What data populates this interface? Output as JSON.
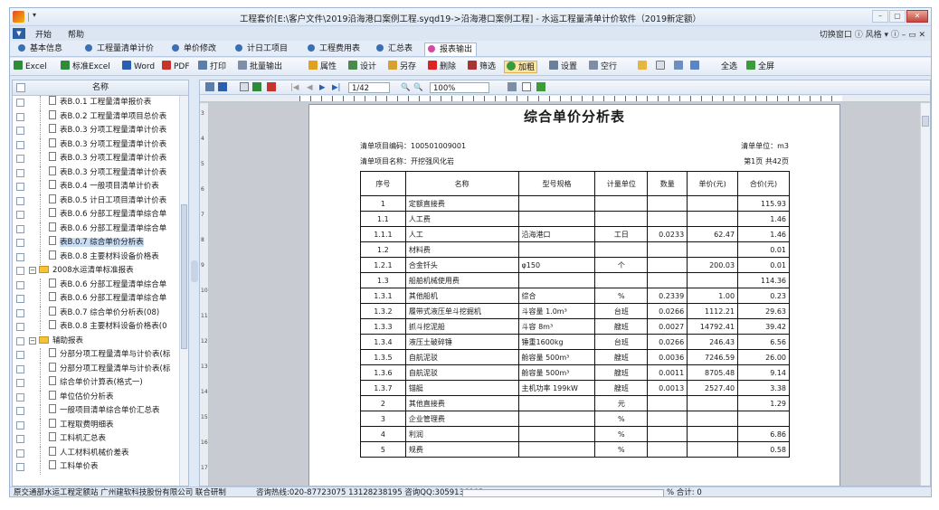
{
  "window": {
    "title": "工程套价[E:\\客户文件\\2019沿海港口案例工程.syqd19->沿海港口案例工程] - 水运工程量清单计价软件（2019新定额）",
    "quick_access": "▾",
    "controls": {
      "min": "–",
      "max": "▢",
      "close": "✕"
    }
  },
  "menu": {
    "dropdown": "▼",
    "items": [
      "开始",
      "帮助"
    ],
    "right": "切换窗口  ⓘ 风格 ▾ ⓘ – ▭ ✕"
  },
  "tabs": [
    "基本信息",
    "工程量清单计价",
    "单价修改",
    "计日工项目",
    "工程费用表",
    "汇总表",
    "报表输出"
  ],
  "toolbar": [
    "Excel",
    "标准Excel",
    "Word",
    "PDF",
    "打印",
    "批量输出",
    "属性",
    "设计",
    "另存",
    "删除",
    "筛选",
    "加粗",
    "设置",
    "空行",
    "全选",
    "全屏"
  ],
  "tree": {
    "header": "名称",
    "items": [
      {
        "label": "表B.0.1 工程量清单报价表",
        "type": "doc",
        "indent": 2
      },
      {
        "label": "表B.0.2 工程量清单项目总价表",
        "type": "doc",
        "indent": 2
      },
      {
        "label": "表B.0.3 分项工程量清单计价表",
        "type": "doc",
        "indent": 2
      },
      {
        "label": "表B.0.3 分项工程量清单计价表",
        "type": "doc",
        "indent": 2
      },
      {
        "label": "表B.0.3 分项工程量清单计价表",
        "type": "doc",
        "indent": 2
      },
      {
        "label": "表B.0.3 分项工程量清单计价表",
        "type": "doc",
        "indent": 2
      },
      {
        "label": "表B.0.4 一般项目清单计价表",
        "type": "doc",
        "indent": 2
      },
      {
        "label": "表B.0.5 计日工项目清单计价表",
        "type": "doc",
        "indent": 2
      },
      {
        "label": "表B.0.6 分部工程量清单综合单",
        "type": "doc",
        "indent": 2
      },
      {
        "label": "表B.0.6 分部工程量清单综合单",
        "type": "doc",
        "indent": 2
      },
      {
        "label": "表B.0.7 综合单价分析表",
        "type": "doc",
        "indent": 2,
        "selected": true
      },
      {
        "label": "表B.0.8 主要材料设备价格表",
        "type": "doc",
        "indent": 2
      },
      {
        "label": "2008水运清单标准报表",
        "type": "folder",
        "indent": 1
      },
      {
        "label": "表B.0.6 分部工程量清单综合单",
        "type": "doc",
        "indent": 2
      },
      {
        "label": "表B.0.6 分部工程量清单综合单",
        "type": "doc",
        "indent": 2
      },
      {
        "label": "表B.0.7 综合单价分析表(08)",
        "type": "doc",
        "indent": 2
      },
      {
        "label": "表B.0.8 主要材料设备价格表(0",
        "type": "doc",
        "indent": 2
      },
      {
        "label": "辅助报表",
        "type": "folder",
        "indent": 1
      },
      {
        "label": "分部分项工程量清单与计价表(标",
        "type": "doc",
        "indent": 2
      },
      {
        "label": "分部分项工程量清单与计价表(标",
        "type": "doc",
        "indent": 2
      },
      {
        "label": "综合单价计算表(格式一)",
        "type": "doc",
        "indent": 2
      },
      {
        "label": "单位估价分析表",
        "type": "doc",
        "indent": 2
      },
      {
        "label": "一般项目清单综合单价汇总表",
        "type": "doc",
        "indent": 2
      },
      {
        "label": "工程取费明细表",
        "type": "doc",
        "indent": 2
      },
      {
        "label": "工料机汇总表",
        "type": "doc",
        "indent": 2
      },
      {
        "label": "人工材料机械价差表",
        "type": "doc",
        "indent": 2
      },
      {
        "label": "工料单价表",
        "type": "doc",
        "indent": 2
      }
    ]
  },
  "preview_toolbar": {
    "page": "1/42",
    "zoom": "100%"
  },
  "vruler": [
    "3",
    "4",
    "5",
    "6",
    "7",
    "8",
    "9",
    "10",
    "11",
    "12",
    "13",
    "14",
    "15",
    "16",
    "17"
  ],
  "report": {
    "title": "综合单价分析表",
    "code_label": "清单项目编码：100501009001",
    "unit_label": "清单单位：m3",
    "name_label": "清单项目名称：开挖强风化岩",
    "page_label": "第1页 共42页",
    "headers": [
      "序号",
      "名称",
      "型号规格",
      "计量单位",
      "数量",
      "单价(元)",
      "合价(元)"
    ],
    "rows": [
      [
        "1",
        "定额直接费",
        "",
        "",
        "",
        "",
        "115.93"
      ],
      [
        "1.1",
        "人工费",
        "",
        "",
        "",
        "",
        "1.46"
      ],
      [
        "1.1.1",
        "人工",
        "沿海港口",
        "工日",
        "0.0233",
        "62.47",
        "1.46"
      ],
      [
        "1.2",
        "材料费",
        "",
        "",
        "",
        "",
        "0.01"
      ],
      [
        "1.2.1",
        "合金钎头",
        "φ150",
        "个",
        "",
        "200.03",
        "0.01"
      ],
      [
        "1.3",
        "船舶机械使用费",
        "",
        "",
        "",
        "",
        "114.36"
      ],
      [
        "1.3.1",
        "其他船机",
        "综合",
        "%",
        "0.2339",
        "1.00",
        "0.23"
      ],
      [
        "1.3.2",
        "履带式液压单斗挖掘机",
        "斗容量 1.0m³",
        "台班",
        "0.0266",
        "1112.21",
        "29.63"
      ],
      [
        "1.3.3",
        "抓斗挖泥船",
        "斗容 8m³",
        "艘班",
        "0.0027",
        "14792.41",
        "39.42"
      ],
      [
        "1.3.4",
        "液压土破碎锤",
        "锤重1600kg",
        "台班",
        "0.0266",
        "246.43",
        "6.56"
      ],
      [
        "1.3.5",
        "自航泥驳",
        "舱容量 500m³",
        "艘班",
        "0.0036",
        "7246.59",
        "26.00"
      ],
      [
        "1.3.6",
        "自航泥驳",
        "舱容量 500m³",
        "艘班",
        "0.0011",
        "8705.48",
        "9.14"
      ],
      [
        "1.3.7",
        "锚艇",
        "主机功率 199kW",
        "艘班",
        "0.0013",
        "2527.40",
        "3.38"
      ],
      [
        "2",
        "其他直接费",
        "",
        "元",
        "",
        "",
        "1.29"
      ],
      [
        "3",
        "企业管理费",
        "",
        "%",
        "",
        "",
        ""
      ],
      [
        "4",
        "利润",
        "",
        "%",
        "",
        "",
        "6.86"
      ],
      [
        "5",
        "规费",
        "",
        "%",
        "",
        "",
        "0.58"
      ]
    ]
  },
  "status": {
    "company": "原交通部水运工程定额站  广州建软科技股份有限公司  联合研制",
    "hotline": "咨询热线:020-87723075  13128238195  咨询QQ:3059136902",
    "total": "% 合计: 0"
  }
}
